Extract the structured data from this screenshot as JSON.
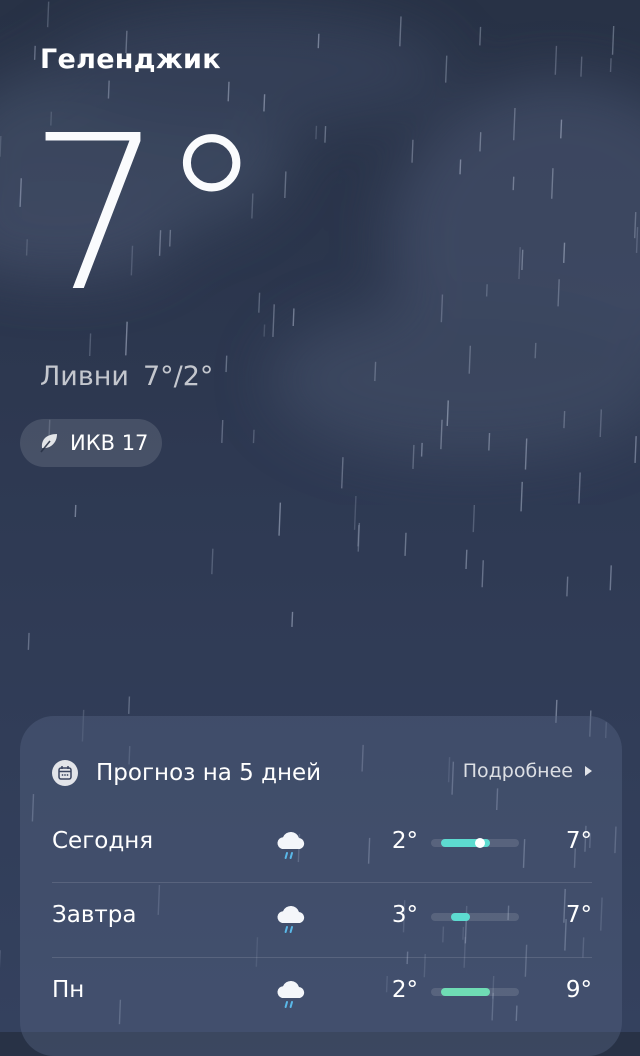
{
  "location": {
    "city": "Геленджик"
  },
  "current": {
    "temperature": "7°",
    "condition": "Ливни",
    "range": "7°/2°",
    "aqi": {
      "icon": "leaf-icon",
      "label": "ИКВ 17"
    }
  },
  "forecast": {
    "icon": "calendar-icon",
    "title": "Прогноз на 5 дней",
    "more_label": "Подробнее",
    "scale": {
      "min": 1,
      "max": 10
    },
    "days": [
      {
        "day": "Сегодня",
        "icon": "rain-cloud-icon",
        "low": "2°",
        "high": "7°",
        "low_value": 2,
        "high_value": 7,
        "current_value": 6,
        "color": "#5ddbd0"
      },
      {
        "day": "Завтра",
        "icon": "rain-cloud-icon",
        "low": "3°",
        "high": "7°",
        "low_value": 3,
        "high_value": 5,
        "color": "#5ddbd0"
      },
      {
        "day": "Пн",
        "icon": "rain-cloud-icon",
        "low": "2°",
        "high": "9°",
        "low_value": 2,
        "high_value": 7,
        "color": "#6fdcb4"
      }
    ]
  },
  "colors": {
    "background": "#2e3952",
    "bar_track": "#4a5570",
    "accent": "#5ddbd0"
  }
}
